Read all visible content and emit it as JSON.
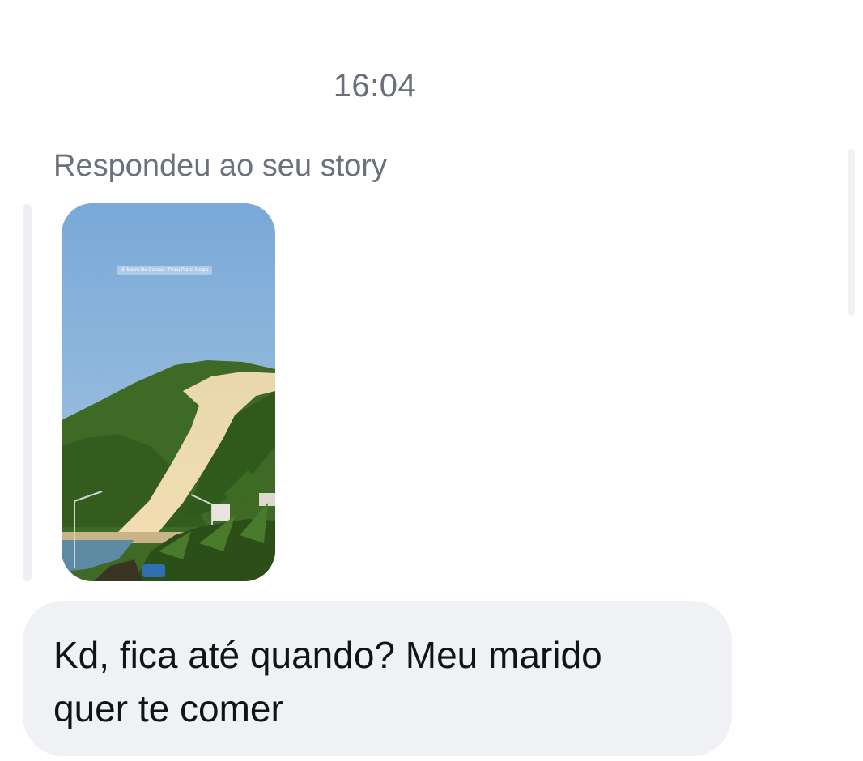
{
  "conversation": {
    "timestamp": "16:04",
    "reply_context": "Respondeu ao seu story",
    "story": {
      "location_label": "Morro Do Careca - Praia Ponta Negra",
      "location_icon": "location-pin-icon"
    },
    "message": {
      "text": "Kd, fica até quando? Meu marido\nquer te comer"
    }
  },
  "colors": {
    "bubble_background": "#eff1f5",
    "secondary_text": "#6b717e",
    "message_text": "#0f1419"
  }
}
